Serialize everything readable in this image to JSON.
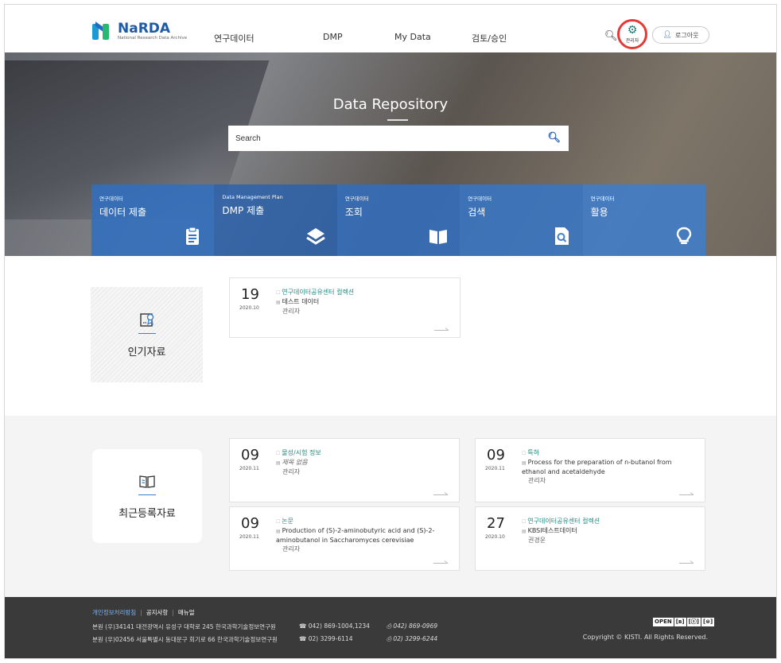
{
  "header": {
    "logo_name": "NaRDA",
    "logo_sub": "National Research Data Archive",
    "nav": [
      "연구데이터",
      "DMP",
      "My Data",
      "검토/승인"
    ],
    "admin_label": "관리자",
    "logout_label": "로그아웃"
  },
  "hero": {
    "title": "Data Repository",
    "search_placeholder": "Search",
    "tiles": [
      {
        "sub": "연구데이터",
        "title": "데이터 제출",
        "icon": "clipboard-icon"
      },
      {
        "sub": "Data Management Plan",
        "title": "DMP 제출",
        "icon": "layers-icon"
      },
      {
        "sub": "연구데이터",
        "title": "조회",
        "icon": "book-icon"
      },
      {
        "sub": "연구데이터",
        "title": "검색",
        "icon": "file-search-icon"
      },
      {
        "sub": "연구데이터",
        "title": "활용",
        "icon": "lightbulb-icon"
      }
    ]
  },
  "popular": {
    "title": "인기자료",
    "items": [
      {
        "day": "19",
        "ym": "2020.10",
        "category": "연구데이터공유센터 컬렉션",
        "title": "테스트 데이터",
        "author": "관리자"
      }
    ]
  },
  "recent": {
    "title": "최근등록자료",
    "items": [
      {
        "day": "09",
        "ym": "2020.11",
        "category": "물성/시험 정보",
        "title": "제목 없음",
        "author": "관리자"
      },
      {
        "day": "09",
        "ym": "2020.11",
        "category": "특허",
        "title": "Process for the preparation of n-butanol from ethanol and acetaldehyde",
        "author": "관리자"
      },
      {
        "day": "09",
        "ym": "2020.11",
        "category": "논문",
        "title": "Production of (S)-2-aminobutyric acid and (S)-2-aminobutanol in Saccharomyces cerevisiae",
        "author": "관리자"
      },
      {
        "day": "27",
        "ym": "2020.10",
        "category": "연구데이터공유센터 컬렉션",
        "title": "KBSI테스트데이터",
        "author": "권경운"
      }
    ]
  },
  "footer": {
    "links": [
      "개인정보처리방침",
      "공지사항",
      "매뉴얼"
    ],
    "addr1": "본원 (우)34141 대전광역시 유성구 대학로 245 한국과학기술정보연구원",
    "tel1": "042) 869-1004,1234",
    "fax1": "042) 869-0969",
    "addr2": "분원 (우)02456 서울특별시 동대문구 회기로 66 한국과학기술정보연구원",
    "tel2": "02) 3299-6114",
    "fax2": "02) 3299-6244",
    "open_badge": [
      "OPEN",
      "[ʙ]",
      "[ⓢ]",
      "[⊜]"
    ],
    "copyright": "Copyright © KISTI. All Rights Reserved."
  },
  "colors": {
    "brand_blue": "#1d5aa8",
    "accent_teal": "#1d8a82",
    "admin_ring": "#e53935"
  }
}
